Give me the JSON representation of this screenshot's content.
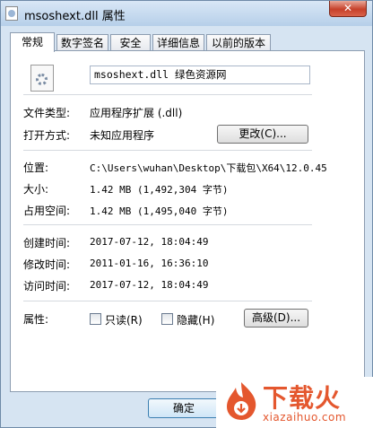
{
  "window": {
    "title": "msoshext.dll 属性",
    "close_glyph": "✕"
  },
  "tabs": [
    {
      "label": "常规"
    },
    {
      "label": "数字签名"
    },
    {
      "label": "安全"
    },
    {
      "label": "详细信息"
    },
    {
      "label": "以前的版本"
    }
  ],
  "general": {
    "file_name": "msoshext.dll 绿色资源网",
    "file_type_label": "文件类型:",
    "file_type_value": "应用程序扩展 (.dll)",
    "opens_with_label": "打开方式:",
    "opens_with_value": "未知应用程序",
    "change_button": "更改(C)...",
    "location_label": "位置:",
    "location_value": "C:\\Users\\wuhan\\Desktop\\下载包\\X64\\12.0.45",
    "size_label": "大小:",
    "size_value": "1.42 MB (1,492,304 字节)",
    "size_on_disk_label": "占用空间:",
    "size_on_disk_value": "1.42 MB (1,495,040 字节)",
    "created_label": "创建时间:",
    "created_value": "2017-07-12, 18:04:49",
    "modified_label": "修改时间:",
    "modified_value": "2011-01-16, 16:36:10",
    "accessed_label": "访问时间:",
    "accessed_value": "2017-07-12, 18:04:49",
    "attributes_label": "属性:",
    "readonly_label": "只读(R)",
    "hidden_label": "隐藏(H)",
    "advanced_button": "高级(D)..."
  },
  "footer": {
    "ok_button": "确定"
  },
  "watermark": {
    "brand": "下载火",
    "url": "xiazaihuo.com"
  }
}
